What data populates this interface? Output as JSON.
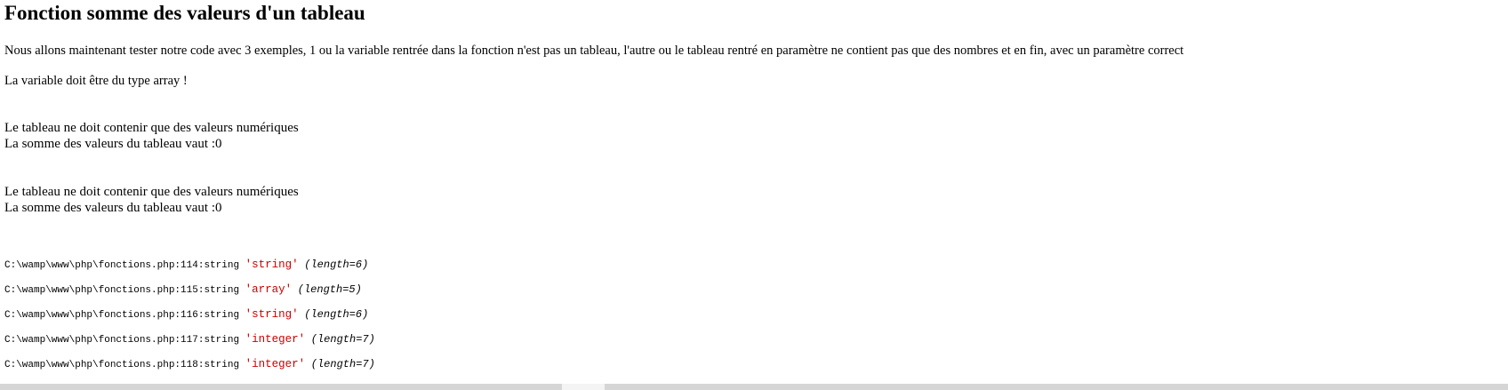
{
  "page": {
    "title": "Fonction somme des valeurs d'un tableau",
    "intro": "Nous allons maintenant tester notre code avec 3 exemples, 1 ou la variable rentrée dans la fonction n'est pas un tableau, l'autre ou le tableau rentré en paramètre ne contient pas que des nombres et en fin, avec un paramètre correct",
    "error_not_array": "La variable doit être du type array !"
  },
  "results": [
    {
      "warning": "Le tableau ne doit contenir que des valeurs numériques",
      "sum": "La somme des valeurs du tableau vaut :0"
    },
    {
      "warning": "Le tableau ne doit contenir que des valeurs numériques",
      "sum": "La somme des valeurs du tableau vaut :0"
    }
  ],
  "dumps": [
    {
      "path": "C:\\wamp\\www\\php\\fonctions.php:114:",
      "type": "string",
      "value": "'string'",
      "length": "(length=6)"
    },
    {
      "path": "C:\\wamp\\www\\php\\fonctions.php:115:",
      "type": "string",
      "value": "'array'",
      "length": "(length=5)"
    },
    {
      "path": "C:\\wamp\\www\\php\\fonctions.php:116:",
      "type": "string",
      "value": "'string'",
      "length": "(length=6)"
    },
    {
      "path": "C:\\wamp\\www\\php\\fonctions.php:117:",
      "type": "string",
      "value": "'integer'",
      "length": "(length=7)"
    },
    {
      "path": "C:\\wamp\\www\\php\\fonctions.php:118:",
      "type": "string",
      "value": "'integer'",
      "length": "(length=7)"
    }
  ],
  "colors": {
    "dump_string_value": "#cc0000",
    "text": "#000000",
    "background": "#ffffff"
  }
}
